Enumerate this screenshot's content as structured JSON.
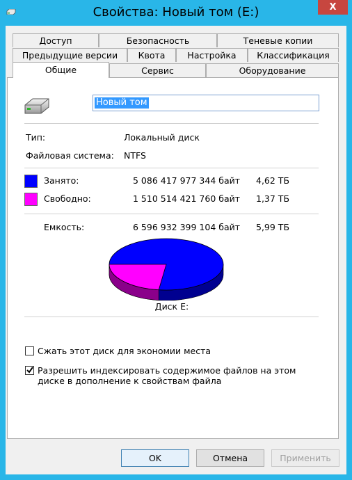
{
  "window": {
    "title": "Свойства: Новый том (E:)",
    "close_glyph": "X"
  },
  "tabs_row1": [
    "Доступ",
    "Безопасность",
    "Теневые копии"
  ],
  "tabs_row2": [
    "Предыдущие версии",
    "Квота",
    "Настройка",
    "Классификация"
  ],
  "tabs_row3": [
    "Общие",
    "Сервис",
    "Оборудование"
  ],
  "volume": {
    "name": "Новый том"
  },
  "info": {
    "type_label": "Тип:",
    "type_value": "Локальный диск",
    "fs_label": "Файловая система:",
    "fs_value": "NTFS"
  },
  "usage": {
    "used_label": "Занято:",
    "used_bytes": "5 086 417 977 344 байт",
    "used_size": "4,62 ТБ",
    "free_label": "Свободно:",
    "free_bytes": "1 510 514 421 760 байт",
    "free_size": "1,37 ТБ",
    "capacity_label": "Емкость:",
    "capacity_bytes": "6 596 932 399 104 байт",
    "capacity_size": "5,99 ТБ",
    "used_color": "#0000ff",
    "free_color": "#ff00ff",
    "used_fraction": 0.771
  },
  "chart_data": {
    "type": "pie",
    "categories": [
      "Занято",
      "Свободно"
    ],
    "values": [
      5086417977344,
      1510514421760
    ],
    "title": "Диск E:"
  },
  "options": {
    "compress_label": "Сжать этот диск для экономии места",
    "compress_checked": false,
    "index_label_line1": "Разрешить индексировать содержимое файлов на этом",
    "index_label_line2": "диске в дополнение к свойствам файла",
    "index_checked": true
  },
  "buttons": {
    "ok": "OK",
    "cancel": "Отмена",
    "apply": "Применить"
  }
}
